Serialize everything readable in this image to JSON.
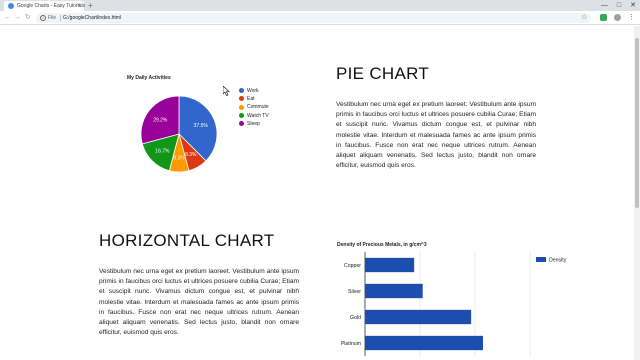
{
  "browser": {
    "tab_title": "Google Charts - Easy Tutorials",
    "tab_close": "×",
    "new_tab": "+",
    "url_scheme": "File",
    "url": "G:/googleChart/index.html",
    "controls": {
      "min": "—",
      "max": "□",
      "close": "✕"
    }
  },
  "pie_section": {
    "heading": "PIE CHART",
    "body": "Vestibulum nec urna eget ex pretium laoreet. Vestibulum ante ipsum primis in faucibus orci luctus et ultrices posuere cubilia Curae; Etiam et suscipit nunc. Vivamus dictum congue est, et pulvinar nibh molestie vitae. Interdum et malesuada fames ac ante ipsum primis in faucibus. Fusce non erat nec neque ultrices rutrum. Aenean aliquet aliquam venenatis. Sed lectus justo, blandit non ornare efficitur, euismod quis eros."
  },
  "bar_section": {
    "heading": "HORIZONTAL CHART",
    "body": "Vestibulum nec urna eget ex pretium laoreet. Vestibulum ante ipsum primis in faucibus orci luctus et ultrices posuere cubilia Curae; Etiam et suscipit nunc. Vivamus dictum congue est, et pulvinar nibh molestie vitae. Interdum et malesuada fames ac ante ipsum primis in faucibus. Fusce non erat nec neque ultrices rutrum. Aenean aliquet aliquam venenatis. Sed lectus justo, blandit non ornare efficitur, euismod quis eros."
  },
  "chart_data": [
    {
      "type": "pie",
      "title": "My Daily Activities",
      "legend_position": "right",
      "slices": [
        {
          "label": "Work",
          "value": 37.5,
          "color": "#3366cc"
        },
        {
          "label": "Eat",
          "value": 8.3,
          "color": "#dc3912"
        },
        {
          "label": "Commute",
          "value": 8.3,
          "color": "#ff9900"
        },
        {
          "label": "Watch TV",
          "value": 16.7,
          "color": "#109618"
        },
        {
          "label": "Sleep",
          "value": 29.2,
          "color": "#990099"
        }
      ]
    },
    {
      "type": "bar",
      "orientation": "horizontal",
      "title": "Density of Precious Metals, in g/cm^3",
      "categories": [
        "Copper",
        "Silver",
        "Gold",
        "Platinum"
      ],
      "series": [
        {
          "name": "Density",
          "values": [
            8.94,
            10.49,
            19.3,
            21.45
          ],
          "color": "#1c4eb0"
        }
      ],
      "xlim": [
        0,
        30
      ],
      "x_ticks": [
        "0",
        "10",
        "20",
        "30"
      ],
      "grid": true,
      "legend_position": "right"
    }
  ]
}
